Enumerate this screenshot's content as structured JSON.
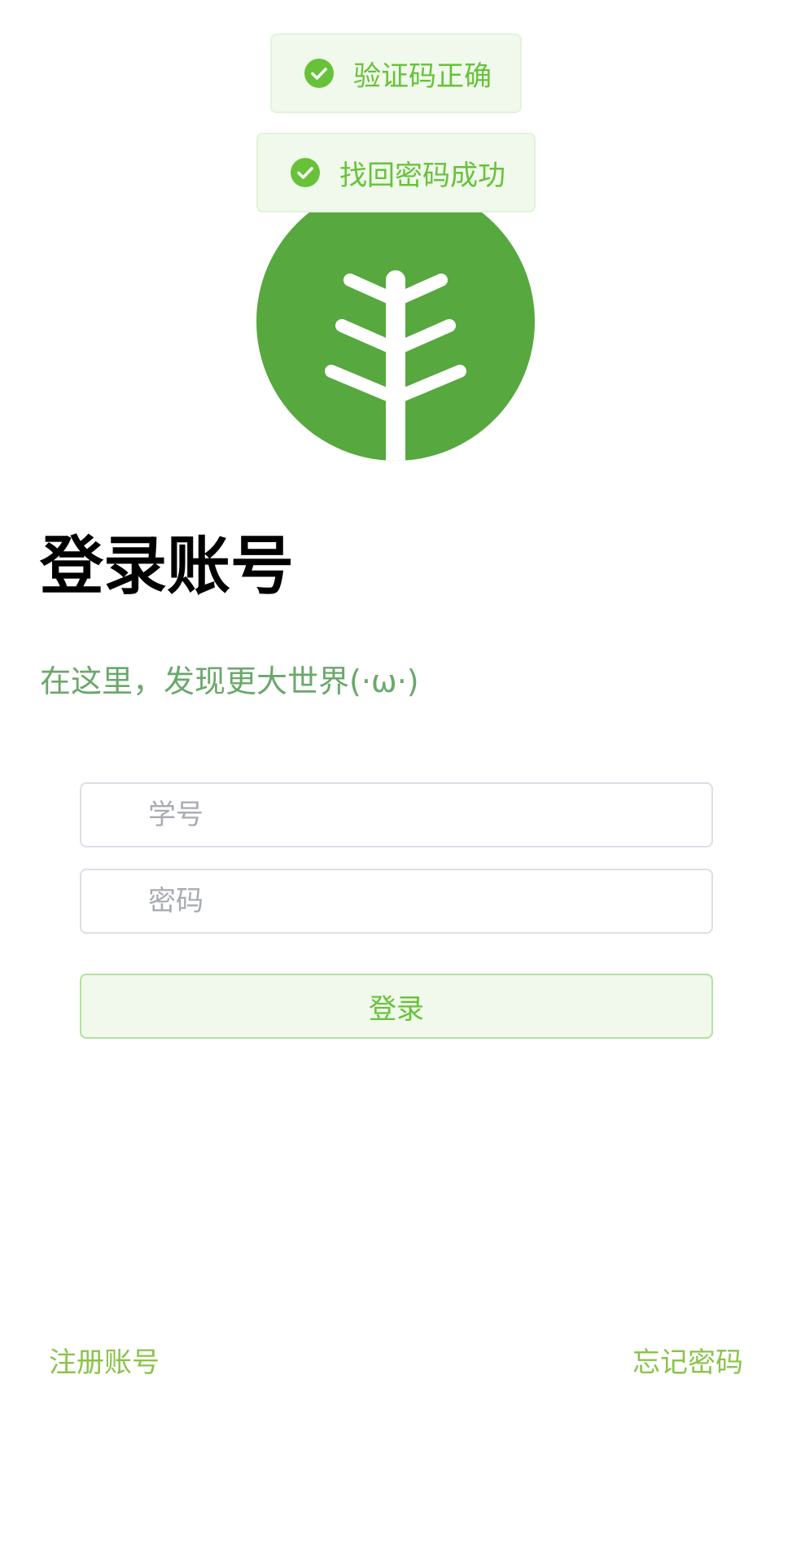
{
  "toasts": [
    {
      "text": "验证码正确",
      "icon": "check-circle-icon"
    },
    {
      "text": "找回密码成功",
      "icon": "check-circle-icon"
    }
  ],
  "logo": {
    "icon": "tree-branch-icon",
    "color": "#56a83f"
  },
  "title": "登录账号",
  "subtitle": "在这里，发现更大世界(·ω·)",
  "form": {
    "student_id_placeholder": "学号",
    "password_placeholder": "密码",
    "login_label": "登录"
  },
  "links": {
    "register": "注册账号",
    "forgot_password": "忘记密码"
  },
  "colors": {
    "success": "#67c23a",
    "link": "#8bc34a",
    "subtitle": "#6aa86a"
  }
}
